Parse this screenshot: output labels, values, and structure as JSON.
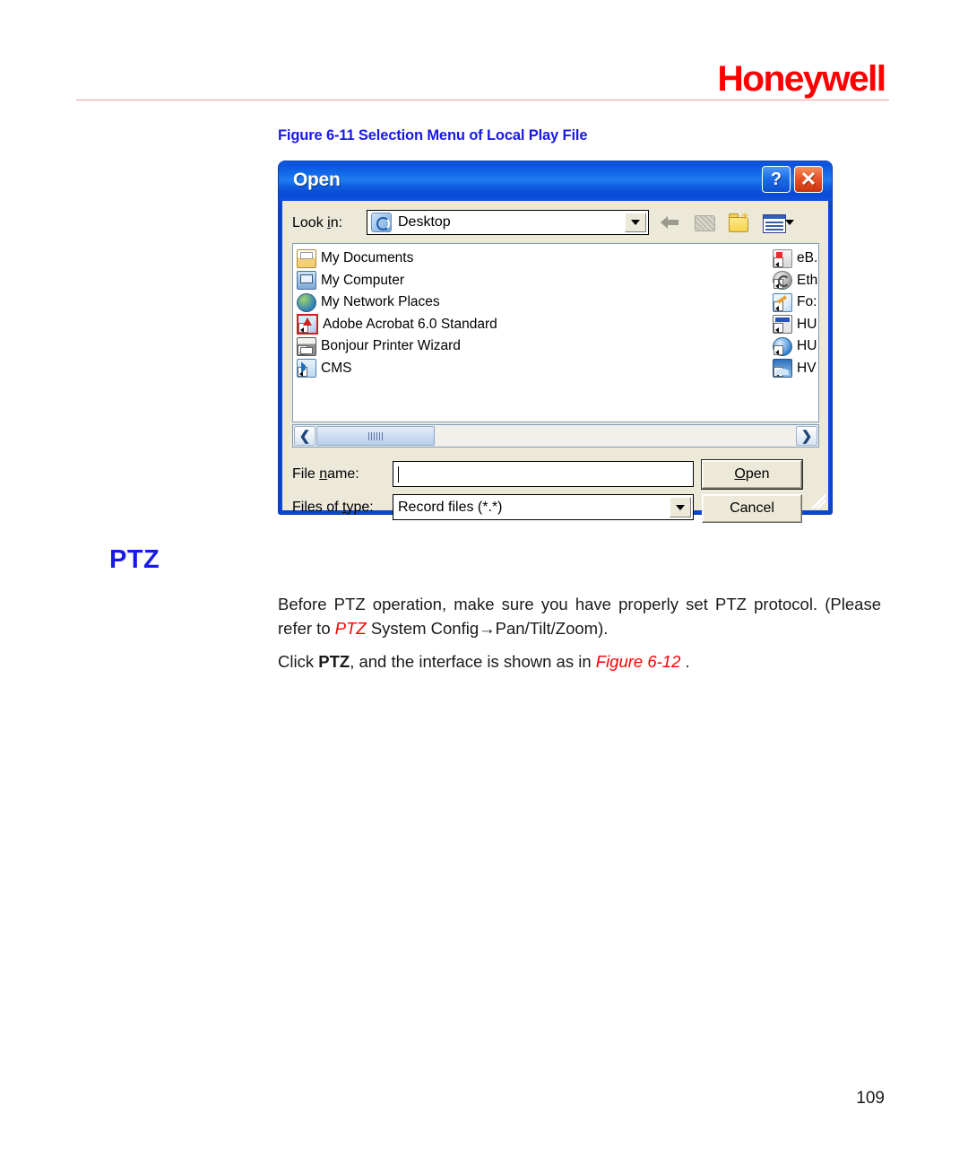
{
  "header": {
    "brand": "Honeywell"
  },
  "figure": {
    "caption": "Figure 6-11 Selection Menu of Local Play File"
  },
  "dialog": {
    "title": "Open",
    "title_buttons": {
      "help": "?",
      "close": "✕"
    },
    "lookin": {
      "label_pre": "Look ",
      "label_underline": "i",
      "label_post": "n:",
      "value": "Desktop"
    },
    "toolbar": [
      {
        "name": "back-button"
      },
      {
        "name": "up-one-level-button"
      },
      {
        "name": "create-new-folder-button"
      },
      {
        "name": "views-button"
      }
    ],
    "file_list_left": [
      {
        "label": "My Documents",
        "icon": "folder-documents-icon",
        "shortcut": false
      },
      {
        "label": "My Computer",
        "icon": "computer-icon",
        "shortcut": false
      },
      {
        "label": "My Network Places",
        "icon": "network-places-icon",
        "shortcut": false
      },
      {
        "label": "Adobe Acrobat 6.0 Standard",
        "icon": "acrobat-icon",
        "shortcut": true
      },
      {
        "label": "Bonjour Printer Wizard",
        "icon": "printer-icon",
        "shortcut": true
      },
      {
        "label": "CMS",
        "icon": "cms-icon",
        "shortcut": true
      }
    ],
    "file_list_right": [
      {
        "label": "eB.",
        "icon": "ebay-shortcut-icon",
        "shortcut": true
      },
      {
        "label": "Eth",
        "icon": "ethereal-shortcut-icon",
        "shortcut": true
      },
      {
        "label": "Fo:",
        "icon": "foxit-shortcut-icon",
        "shortcut": true
      },
      {
        "label": "HU",
        "icon": "hu-window-shortcut-icon",
        "shortcut": true
      },
      {
        "label": "HU",
        "icon": "hu-globe-shortcut-icon",
        "shortcut": true
      },
      {
        "label": "HV",
        "icon": "hv-shortcut-icon",
        "shortcut": true
      }
    ],
    "scroll": {
      "left_arrow": "❮",
      "right_arrow": "❯"
    },
    "filename": {
      "label_pre": "File ",
      "label_underline": "n",
      "label_post": "ame:",
      "value": "",
      "placeholder": ""
    },
    "filetype": {
      "label_pre": "Files of ",
      "label_underline": "t",
      "label_post": "ype:",
      "value": "Record files (*.*)"
    },
    "buttons": {
      "open_pre": "",
      "open_underline": "O",
      "open_post": "pen",
      "cancel": "Cancel"
    }
  },
  "section": {
    "heading": "PTZ",
    "paragraph1_part1": "Before PTZ operation, make sure you have properly set PTZ protocol. (Please refer to ",
    "paragraph1_ptz": "PTZ",
    "paragraph1_part2": " System Config→Pan/Tilt/Zoom).",
    "paragraph2_part1": "Click ",
    "paragraph2_bold": "PTZ",
    "paragraph2_part2": ", and the interface is shown as in ",
    "paragraph2_figure": "Figure 6-12",
    "paragraph2_part3": " ."
  },
  "footer": {
    "page_number": "109"
  },
  "colors": {
    "brand_red": "#ff0000",
    "heading_blue": "#1a1ae8",
    "titlebar_blue": "#1068e8",
    "dialog_face": "#ece9d8"
  }
}
